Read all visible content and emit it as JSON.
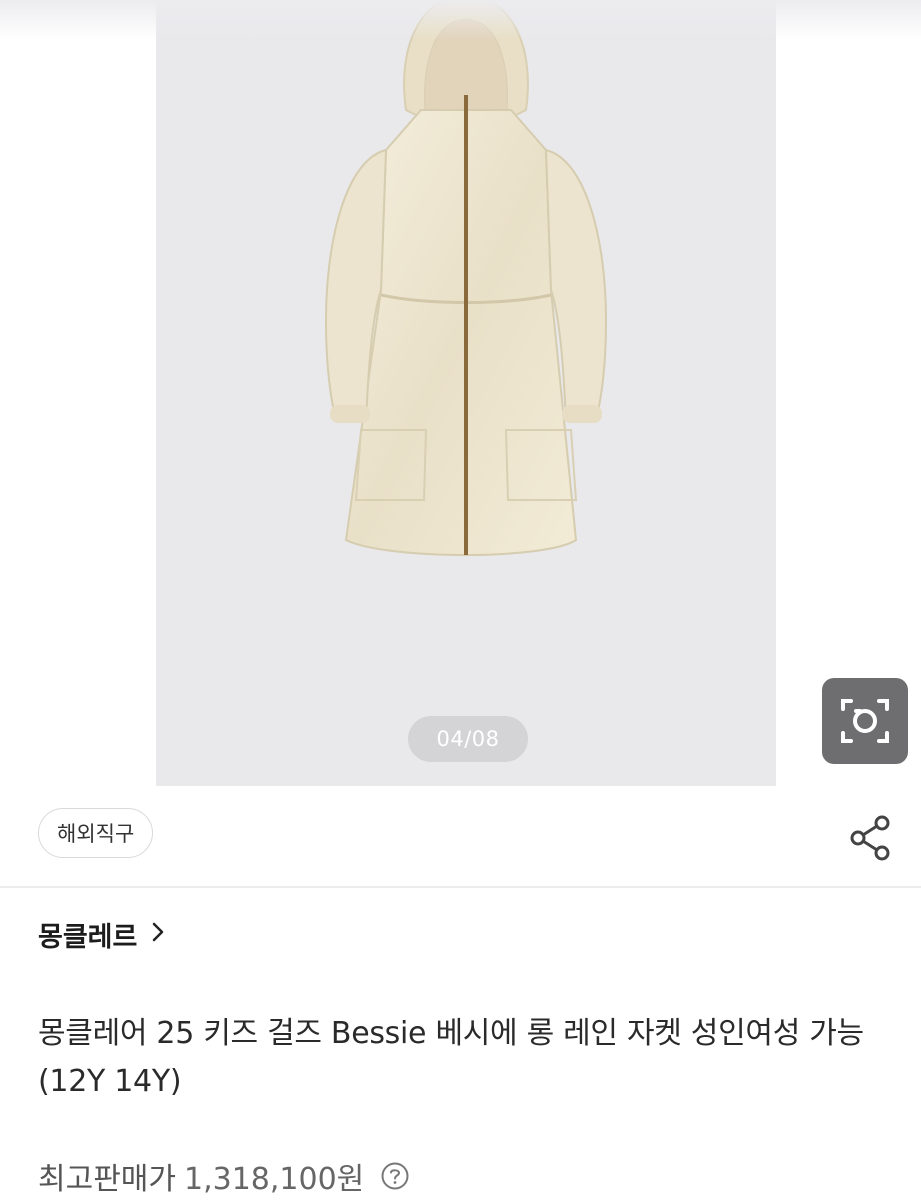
{
  "gallery": {
    "counter": "04/08",
    "product_image_alt": "beige hooded long rain jacket",
    "lens_icon": "camera-lens-icon"
  },
  "badge": {
    "overseas_label": "해외직구"
  },
  "share_icon": "share-icon",
  "brand": {
    "name": "몽클레르",
    "chevron_icon": "chevron-right-icon"
  },
  "product": {
    "title": "몽클레어 25 키즈 걸즈 Bessie 베시에 롱 레인 자켓 성인여성 가능 (12Y 14Y)"
  },
  "price": {
    "label": "최고판매가",
    "value": "1,318,100원",
    "help_icon": "question-circle-icon"
  },
  "colors": {
    "image_bg": "#e9e9ec",
    "jacket": "#efe8d3",
    "zipper": "#8a6a3a",
    "lens_button_bg": "#6e6e70"
  }
}
